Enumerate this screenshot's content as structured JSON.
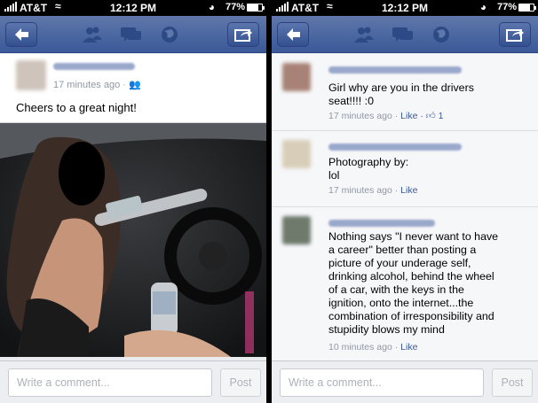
{
  "status": {
    "carrier": "AT&T",
    "time": "12:12 PM",
    "battery": "77%"
  },
  "left": {
    "post_meta": "17 minutes ago ·",
    "post_text": "Cheers to a great night!",
    "comment_placeholder": "Write a comment...",
    "post_button": "Post"
  },
  "right": {
    "comments": [
      {
        "text_lines": [
          "Girl why are you in the drivers",
          "seat!!!! :0"
        ],
        "time": "17 minutes ago ·",
        "like_label": "Like ·",
        "likes": "1"
      },
      {
        "text_lines": [
          "Photography by:",
          "lol"
        ],
        "time": "17 minutes ago ·",
        "like_label": "Like"
      },
      {
        "text_lines": [
          "Nothing says \"I never want to have",
          "a career\" better than posting a",
          "picture of your underage self,",
          "drinking alcohol, behind the wheel",
          "of a car, with the keys in the",
          "ignition, onto the internet...the",
          "combination of irresponsibility and",
          "stupidity blows my mind"
        ],
        "time": "10 minutes ago ·",
        "like_label": "Like"
      }
    ],
    "comment_placeholder": "Write a comment...",
    "post_button": "Post"
  },
  "colors": {
    "nav": "#3b5998",
    "link": "#3b5998",
    "meta": "#9197a3"
  }
}
